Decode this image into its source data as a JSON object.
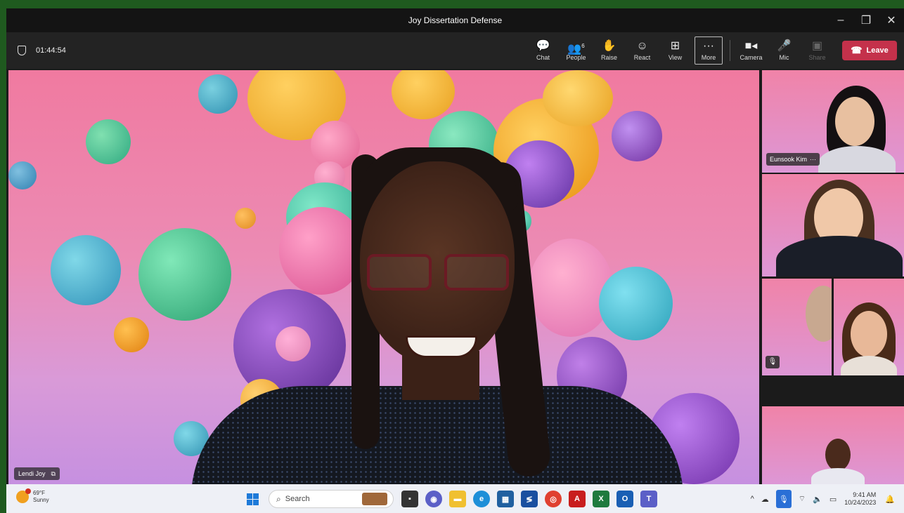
{
  "window": {
    "title": "Joy Dissertation Defense",
    "controls": [
      "–",
      "❐",
      "✕"
    ]
  },
  "toolbar": {
    "timer": "01:44:54",
    "chat": "Chat",
    "people": "People",
    "people_count": "6",
    "raise": "Raise",
    "react": "React",
    "view": "View",
    "more": "More",
    "camera": "Camera",
    "mic": "Mic",
    "share": "Share",
    "leave": "Leave"
  },
  "stage": {
    "speaker_name": "Lendi Joy"
  },
  "participants": {
    "kim_name": "Eunsook Kim",
    "kim_more": "···"
  },
  "taskbar": {
    "temperature": "69°F",
    "weather": "Sunny",
    "search_label": "Search",
    "time": "9:41 AM",
    "date": "10/24/2023"
  }
}
